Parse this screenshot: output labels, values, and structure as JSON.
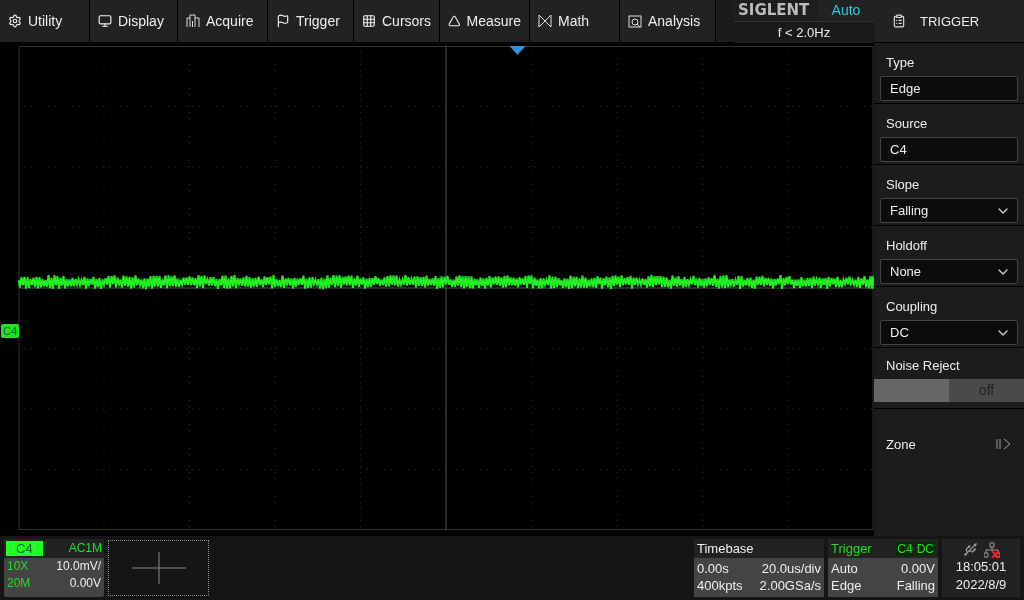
{
  "menu": [
    {
      "label": "Utility"
    },
    {
      "label": "Display"
    },
    {
      "label": "Acquire"
    },
    {
      "label": "Trigger"
    },
    {
      "label": "Cursors"
    },
    {
      "label": "Measure"
    },
    {
      "label": "Math"
    },
    {
      "label": "Analysis"
    }
  ],
  "status": {
    "brand": "SIGLENT",
    "mode": "Auto",
    "frequency": "f < 2.0Hz"
  },
  "panel": {
    "title": "TRIGGER",
    "fields": [
      {
        "kind": "value",
        "label": "Type",
        "value": "Edge"
      },
      {
        "kind": "value",
        "label": "Source",
        "value": "C4"
      },
      {
        "kind": "dropdown",
        "label": "Slope",
        "value": "Falling"
      },
      {
        "kind": "dropdown",
        "label": "Holdoff",
        "value": "None"
      },
      {
        "kind": "dropdown",
        "label": "Coupling",
        "value": "DC"
      },
      {
        "kind": "toggle",
        "label": "Noise Reject",
        "value": "off",
        "on": false
      },
      {
        "kind": "link",
        "label": "Zone"
      }
    ]
  },
  "scope": {
    "channel_marker": "C4"
  },
  "channel": {
    "name": "C4",
    "coupling": "AC1M",
    "probe": "10X",
    "scale": "10.0mV/",
    "bandwidth": "20M",
    "offset": "0.00V"
  },
  "timebase": {
    "title": "Timebase",
    "delay": "0.00s",
    "scale": "20.0us/div",
    "depth": "400kpts",
    "rate": "2.00GSa/s"
  },
  "trigger": {
    "title": "Trigger",
    "source": "C4",
    "coupling": "DC",
    "mode": "Auto",
    "level": "0.00V",
    "type": "Edge",
    "slope": "Falling"
  },
  "clock": {
    "time": "18:05:01",
    "date": "2022/8/9"
  }
}
